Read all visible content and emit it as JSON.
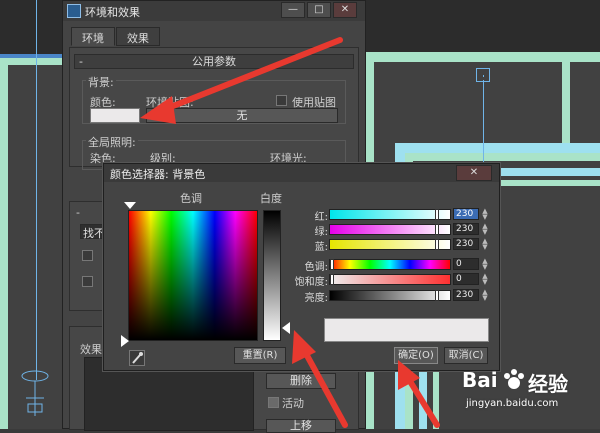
{
  "env_dialog": {
    "title": "环境和效果",
    "window_buttons": [
      "—",
      "□",
      "✕"
    ],
    "tabs": [
      {
        "label": "环境"
      },
      {
        "label": "效果"
      }
    ],
    "common_params": {
      "header": "公用参数",
      "collapse": "-",
      "background_group": "背景:",
      "color_label": "颜色:",
      "env_map_label": "环境贴图:",
      "use_map_label": "使用贴图",
      "map_button": "无",
      "global_lighting_group": "全局照明:",
      "tint_label": "染色:",
      "level_label": "级别:",
      "ambient_label": "环境光:"
    },
    "fragments": {
      "collapse2": "-",
      "dropdown_partial": "找不",
      "black_partial": "黑",
      "degree_partial": "度",
      "effects_partial": "效果",
      "delete_button": "删除",
      "active_label": "活动",
      "move_up_partial": "上移"
    }
  },
  "picker": {
    "title": "颜色选择器: 背景色",
    "close": "✕",
    "hue_header": "色调",
    "whiteness_header": "白度",
    "sliders": [
      {
        "label": "红:",
        "value": "230",
        "gradient": "linear-gradient(to right,#00e6ea,#fff)",
        "selected": true
      },
      {
        "label": "绿:",
        "value": "230",
        "gradient": "linear-gradient(to right,#e600ea,#fff)"
      },
      {
        "label": "蓝:",
        "value": "230",
        "gradient": "linear-gradient(to right,#e6e600,#fff)"
      },
      {
        "label": "色调:",
        "value": "0",
        "gradient": "linear-gradient(to right,#f00,#ff0,#0f0,#0ff,#00f,#f0f,#f00)"
      },
      {
        "label": "饱和度:",
        "value": "0",
        "gradient": "linear-gradient(to right,#eee,#ff3030)"
      },
      {
        "label": "亮度:",
        "value": "230",
        "gradient": "linear-gradient(to right,#000,#fff)"
      }
    ],
    "reset_button": "重置(R)",
    "ok_button": "确定(O)",
    "cancel_button": "取消(C)",
    "preview_color": "#ebe9ea"
  },
  "watermark": {
    "brand": "Bai",
    "brand_cn": "经验",
    "url": "jingyan.baidu.com"
  },
  "colors": {
    "arrow": "#e8392f",
    "accent": "#3b6cb4"
  }
}
